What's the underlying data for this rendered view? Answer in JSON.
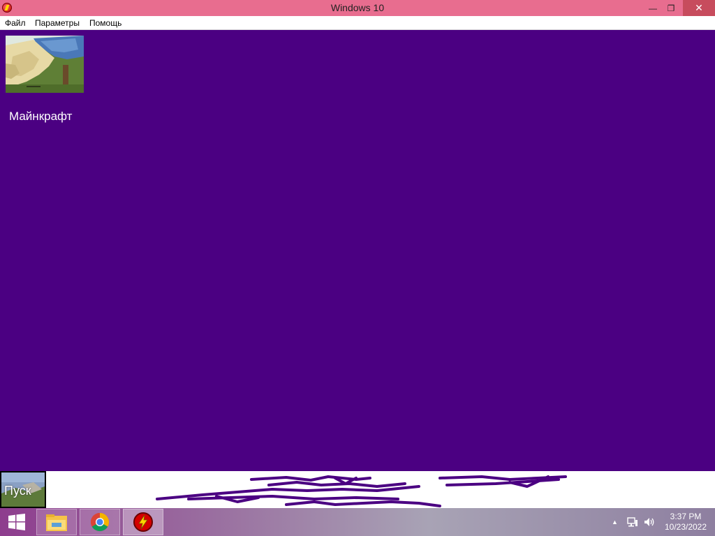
{
  "window": {
    "title": "Windows 10",
    "icon": "red-lightning-app-icon",
    "minimize_glyph": "—",
    "restore_glyph": "❐",
    "close_glyph": "✕"
  },
  "menu": {
    "items": [
      "Файл",
      "Параметры",
      "Помощь"
    ]
  },
  "desktop": {
    "background_color": "#4b0082",
    "icons": [
      {
        "label": "Майнкрафт",
        "icon": "minecraft-thumbnail"
      }
    ]
  },
  "start_button": {
    "label": "Пуск"
  },
  "taskbar": {
    "pinned": [
      "file-explorer-icon",
      "chrome-icon",
      "red-lightning-app-icon"
    ],
    "clock": {
      "time": "3:37 PM",
      "date": "10/23/2022"
    },
    "tray": [
      "show-hidden-icons",
      "network-icon",
      "volume-icon"
    ]
  }
}
